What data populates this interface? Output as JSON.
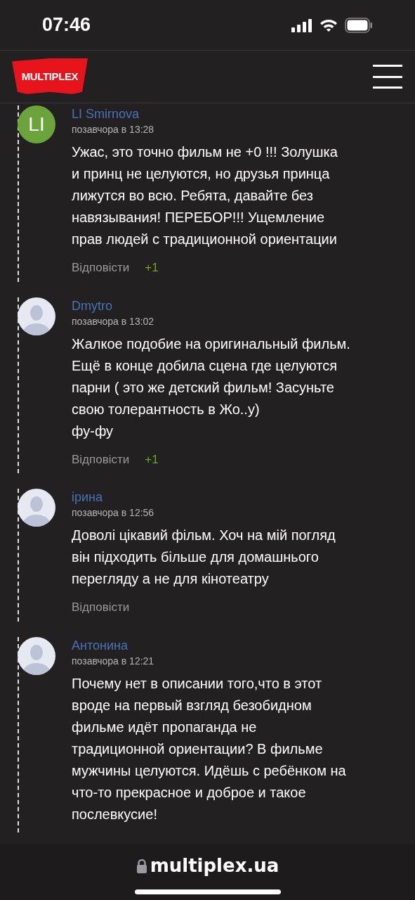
{
  "status_bar": {
    "time": "07:46"
  },
  "header": {
    "logo": "MULTIPLEX"
  },
  "comments": [
    {
      "author": "LI Smirnova",
      "avatar": {
        "kind": "initials",
        "text": "LI",
        "color": "#6aa43a"
      },
      "date": "позавчора в 13:28",
      "text": "Ужас, это точно фильм не +0 !!! Золушка\nи принц не целуются, но друзья принца\nлижутся во всю. Ребята, давайте без\nнавязывания! ПЕРЕБОР!!! Ущемление\nправ людей с традиционной ориентации",
      "reply": "Відповісти",
      "votes": "+1"
    },
    {
      "author": "Dmytro",
      "avatar": {
        "kind": "silhouette"
      },
      "date": "позавчора в 13:02",
      "text": "Жалкое подобие на оригинальный фильм.\nЕщё в конце добила сцена где целуются\nпарни ( это же детский фильм! Засуньте\nсвою толерантность в Жо..у)\nфу-фу",
      "reply": "Відповісти",
      "votes": "+1"
    },
    {
      "author": "ірина",
      "avatar": {
        "kind": "silhouette"
      },
      "date": "позавчора в 12:56",
      "text": "Доволі цікавий фільм. Хоч на мій погляд\nвін підходить більше для домашнього\nперегляду а не для кінотеатру",
      "reply": "Відповісти"
    },
    {
      "author": "Антонина",
      "avatar": {
        "kind": "silhouette"
      },
      "date": "позавчора в 12:21",
      "text": "Почему нет в описании того,что в этот\nвроде на первый взгляд безобидном\nфильме идёт пропаганда не\nтрадиционной ориентации? В фильме\nмужчины целуются. Идёшь с ребёнком на\nчто-то прекрасное и доброе и такое\nпослевкусие!"
    }
  ],
  "browser_bar": {
    "url": "multiplex.ua"
  }
}
